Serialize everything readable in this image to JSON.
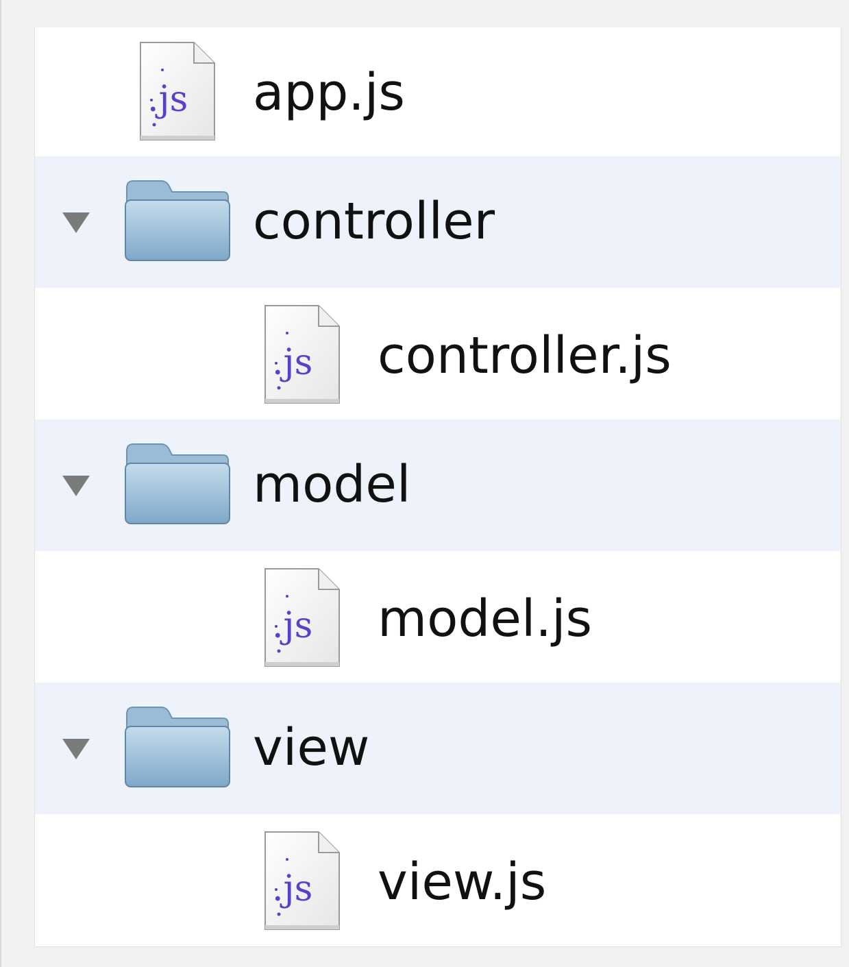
{
  "tree": {
    "items": [
      {
        "kind": "file",
        "name": "app.js",
        "icon": "js-file-icon",
        "depth": 0
      },
      {
        "kind": "folder",
        "name": "controller",
        "icon": "folder-icon",
        "expanded": true,
        "depth": 0
      },
      {
        "kind": "file",
        "name": "controller.js",
        "icon": "js-file-icon",
        "depth": 1
      },
      {
        "kind": "folder",
        "name": "model",
        "icon": "folder-icon",
        "expanded": true,
        "depth": 0
      },
      {
        "kind": "file",
        "name": "model.js",
        "icon": "js-file-icon",
        "depth": 1
      },
      {
        "kind": "folder",
        "name": "view",
        "icon": "folder-icon",
        "expanded": true,
        "depth": 0
      },
      {
        "kind": "file",
        "name": "view.js",
        "icon": "js-file-icon",
        "depth": 1
      }
    ],
    "icon_text": ".js",
    "colors": {
      "alt_row": "#eef2fa",
      "folder": "#7fa8c8",
      "js_text": "#5b3fc8",
      "disclosure": "#7b7b7b"
    }
  }
}
